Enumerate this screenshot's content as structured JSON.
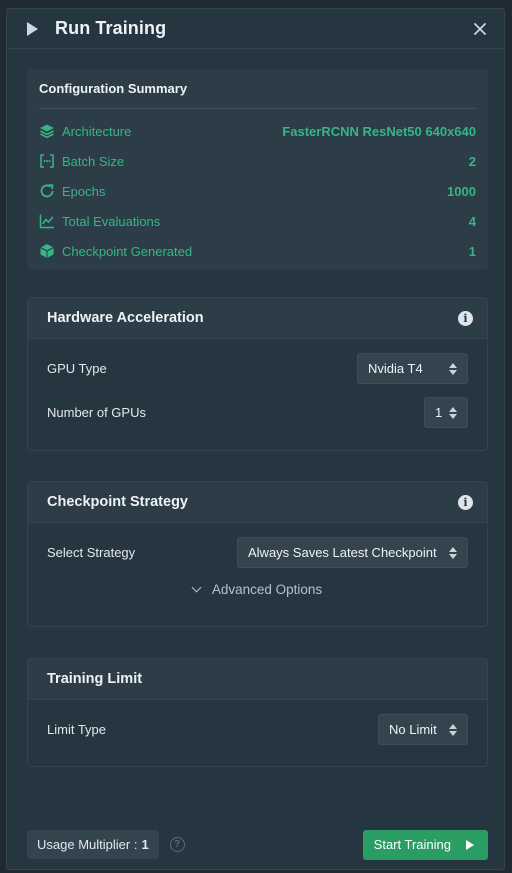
{
  "header": {
    "title": "Run Training"
  },
  "summary": {
    "title": "Configuration Summary",
    "rows": [
      {
        "label": "Architecture",
        "value": "FasterRCNN ResNet50 640x640",
        "icon": "layers-icon"
      },
      {
        "label": "Batch Size",
        "value": "2",
        "icon": "bracket-dots-icon"
      },
      {
        "label": "Epochs",
        "value": "1000",
        "icon": "refresh-icon"
      },
      {
        "label": "Total Evaluations",
        "value": "4",
        "icon": "chart-line-icon"
      },
      {
        "label": "Checkpoint Generated",
        "value": "1",
        "icon": "cube-icon"
      }
    ]
  },
  "hardware": {
    "title": "Hardware Acceleration",
    "gpu_type_label": "GPU Type",
    "gpu_type_value": "Nvidia T4",
    "gpu_count_label": "Number of GPUs",
    "gpu_count_value": "1"
  },
  "checkpoint": {
    "title": "Checkpoint Strategy",
    "strategy_label": "Select Strategy",
    "strategy_value": "Always Saves Latest Checkpoint",
    "advanced_label": "Advanced Options"
  },
  "limit": {
    "title": "Training Limit",
    "type_label": "Limit Type",
    "type_value": "No Limit"
  },
  "footer": {
    "multiplier_label": "Usage Multiplier :",
    "multiplier_value": "1",
    "start_label": "Start Training"
  },
  "colors": {
    "accent": "#36b585",
    "start_button": "#2a9d63",
    "panel": "#263640"
  }
}
